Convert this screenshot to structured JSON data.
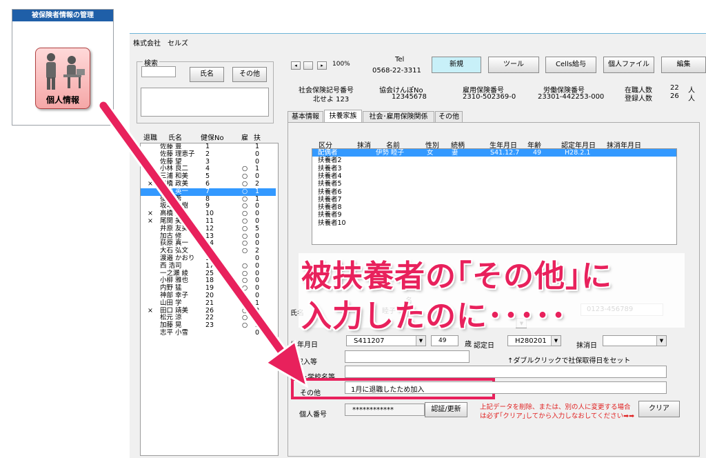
{
  "info_box": {
    "title": "被保険者情報の管理",
    "button_label": "個人情報"
  },
  "company": "株式会社　セルズ",
  "search": {
    "group_label": "検索",
    "name_button": "氏名",
    "other_button": "その他",
    "input_value": ""
  },
  "list": {
    "headers": [
      "退職",
      "氏名",
      "健保No",
      "雇",
      "扶"
    ],
    "rows": [
      {
        "ret": "",
        "name": "佐藤 豊",
        "no": "1",
        "emp": "",
        "dep": "1"
      },
      {
        "ret": "",
        "name": "佐藤 理恵子",
        "no": "2",
        "emp": "",
        "dep": "0"
      },
      {
        "ret": "",
        "name": "佐藤 望",
        "no": "3",
        "emp": "",
        "dep": "0"
      },
      {
        "ret": "",
        "name": "小林 良二",
        "no": "4",
        "emp": "○",
        "dep": "1"
      },
      {
        "ret": "",
        "name": "三浦 和美",
        "no": "5",
        "emp": "○",
        "dep": "0"
      },
      {
        "ret": "×",
        "name": "高橋 政美",
        "no": "6",
        "emp": "○",
        "dep": "2"
      },
      {
        "ret": "",
        "name": "伊勢 英一",
        "no": "7",
        "emp": "○",
        "dep": "1",
        "selected": true
      },
      {
        "ret": "",
        "name": "後藤 希",
        "no": "8",
        "emp": "○",
        "dep": "1"
      },
      {
        "ret": "",
        "name": "坂本 秀樹",
        "no": "9",
        "emp": "○",
        "dep": "0"
      },
      {
        "ret": "×",
        "name": "高橋 力",
        "no": "10",
        "emp": "○",
        "dep": "0"
      },
      {
        "ret": "×",
        "name": "尾関 美香",
        "no": "11",
        "emp": "○",
        "dep": "0"
      },
      {
        "ret": "",
        "name": "井原 友美",
        "no": "12",
        "emp": "○",
        "dep": "5"
      },
      {
        "ret": "",
        "name": "加古 修",
        "no": "13",
        "emp": "○",
        "dep": "0"
      },
      {
        "ret": "",
        "name": "荻原 真一",
        "no": "14",
        "emp": "○",
        "dep": "0"
      },
      {
        "ret": "",
        "name": "大石 弘文",
        "no": "15",
        "emp": "○",
        "dep": "2"
      },
      {
        "ret": "",
        "name": "渡邉 かおり",
        "no": "16",
        "emp": "",
        "dep": "0"
      },
      {
        "ret": "",
        "name": "西 浩司",
        "no": "17",
        "emp": "○",
        "dep": "0"
      },
      {
        "ret": "",
        "name": "一之瀬 綾",
        "no": "25",
        "emp": "○",
        "dep": "0"
      },
      {
        "ret": "",
        "name": "小柳 雅也",
        "no": "18",
        "emp": "○",
        "dep": "0"
      },
      {
        "ret": "",
        "name": "内野 猛",
        "no": "19",
        "emp": "○",
        "dep": "0"
      },
      {
        "ret": "",
        "name": "神部 幸子",
        "no": "20",
        "emp": "○",
        "dep": "0"
      },
      {
        "ret": "",
        "name": "山田 学",
        "no": "21",
        "emp": "○",
        "dep": "1"
      },
      {
        "ret": "×",
        "name": "田口 靖美",
        "no": "26",
        "emp": "○",
        "dep": "0"
      },
      {
        "ret": "",
        "name": "松元 涼",
        "no": "22",
        "emp": "○",
        "dep": "2"
      },
      {
        "ret": "",
        "name": "加藤 晃",
        "no": "23",
        "emp": "○",
        "dep": "3"
      },
      {
        "ret": "",
        "name": "志平 小雪",
        "no": "",
        "emp": "",
        "dep": "0"
      }
    ]
  },
  "toolbar": {
    "zoom": "100%",
    "tel_label": "Tel",
    "tel_value": "0568-22-3311",
    "new_button": "新規",
    "tool_button": "ツール",
    "cells_button": "Cells給与",
    "file_button": "個人ファイル",
    "edit_button": "編集"
  },
  "summary": {
    "social_label": "社会保険記号番号",
    "social_value": "北せよ 123",
    "kenpo_label": "協会けんぽNo",
    "kenpo_value": "12345678",
    "koyo_label": "雇用保険番号",
    "koyo_value": "2310-502369-0",
    "rodo_label": "労働保険番号",
    "rodo_value": "23301-442253-000",
    "zaishoku_label": "在職人数",
    "zaishoku_value": "22",
    "zaishoku_unit": "人",
    "toroku_label": "登録人数",
    "toroku_value": "26",
    "toroku_unit": "人"
  },
  "tabs": [
    "基本情報",
    "扶養家族",
    "社会･雇用保険関係",
    "その他"
  ],
  "dependents": {
    "headers": [
      "区分",
      "抹消",
      "名前",
      "性別",
      "続柄",
      "生年月日",
      "年齢",
      "認定年月日",
      "抹消年月日"
    ],
    "rows": [
      {
        "kubun": "配偶者",
        "name": "伊勢 睦子",
        "sex": "女",
        "rel": "妻",
        "birth": "S41.12.7",
        "age": "49",
        "nintei": "H28.2.1",
        "selected": true
      },
      {
        "kubun": "扶養者2"
      },
      {
        "kubun": "扶養者3"
      },
      {
        "kubun": "扶養者4"
      },
      {
        "kubun": "扶養者5"
      },
      {
        "kubun": "扶養者6"
      },
      {
        "kubun": "扶養者7"
      },
      {
        "kubun": "扶養者8"
      },
      {
        "kubun": "扶養者9"
      },
      {
        "kubun": "扶養者10"
      }
    ]
  },
  "form": {
    "name_label": "氏名",
    "name_peek_1": "名",
    "name_peek_2": "睦子",
    "phone_value": "0123-456789",
    "birth_label": "生年月日",
    "birth_value": "S411207",
    "age_value": "49",
    "age_unit": "歳",
    "nintei_label": "認定日",
    "nintei_value": "H280201",
    "masshou_label": "抹消日",
    "income_label": "収入等",
    "hint": "↑ダブルクリックで社保取得日をセット",
    "school_label": "勤務･学校名等",
    "other_label": "その他",
    "other_value": "1月に退職したため加入",
    "mynumber_label": "個人番号",
    "mynumber_value": "************",
    "auth_button": "認証/更新",
    "warning_line1": "上記データを削除、または、別の人に変更する場合",
    "warning_line2": "は必ず｢クリア｣してから入力しなおしてください➡➡",
    "clear_button": "クリア"
  },
  "overlay": {
    "line1": "被扶養者の｢その他｣に",
    "line2": "入力したのに･････"
  },
  "colors": {
    "accent_pink": "#e8215c",
    "selection": "#3399ff",
    "title_blue": "#1f5fa8",
    "new_button": "#c8f0f8"
  }
}
